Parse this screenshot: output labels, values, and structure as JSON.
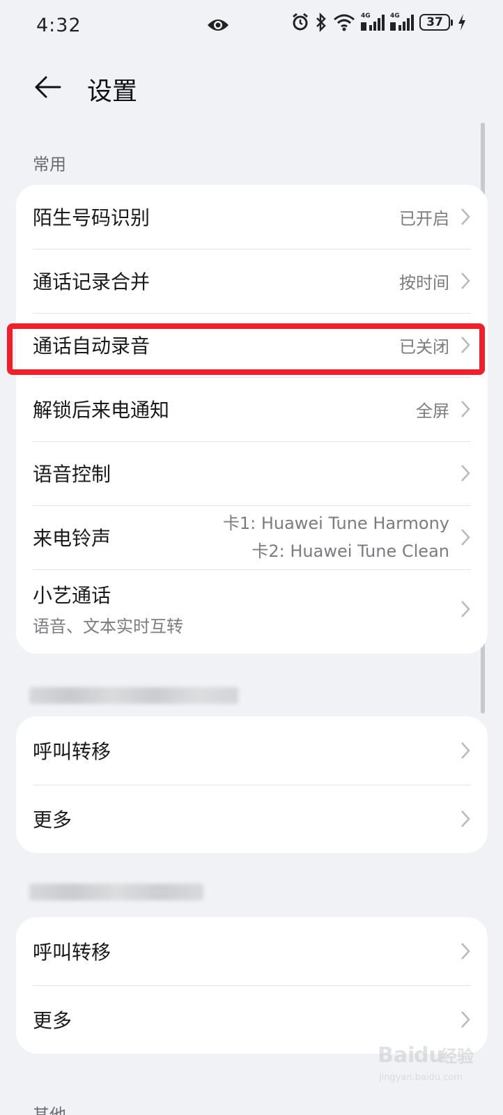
{
  "status_bar": {
    "time": "4:32",
    "net1": "4G",
    "net2": "4G",
    "battery": "37"
  },
  "header": {
    "title": "设置"
  },
  "sections": {
    "common": "常用",
    "other": "其他"
  },
  "common_items": [
    {
      "label": "陌生号码识别",
      "value": "已开启"
    },
    {
      "label": "通话记录合并",
      "value": "按时间"
    },
    {
      "label": "通话自动录音",
      "value": "已关闭"
    },
    {
      "label": "解锁后来电通知",
      "value": "全屏"
    },
    {
      "label": "语音控制",
      "value": ""
    },
    {
      "label": "来电铃声",
      "value_line1": "卡1: Huawei Tune Harmony",
      "value_line2": "卡2: Huawei Tune Clean"
    },
    {
      "label": "小艺通话",
      "sub": "语音、文本实时互转"
    }
  ],
  "sim1_items": [
    {
      "label": "呼叫转移"
    },
    {
      "label": "更多"
    }
  ],
  "sim2_items": [
    {
      "label": "呼叫转移"
    },
    {
      "label": "更多"
    }
  ],
  "watermark": {
    "line1": "Bai",
    "line1b": "du",
    "line1c": "经验",
    "line2": "jingyan.baidu.com"
  },
  "colors": {
    "background": "#f1f2f5",
    "card": "#ffffff",
    "highlight": "#f0202b",
    "secondary_text": "#7a7c80"
  }
}
